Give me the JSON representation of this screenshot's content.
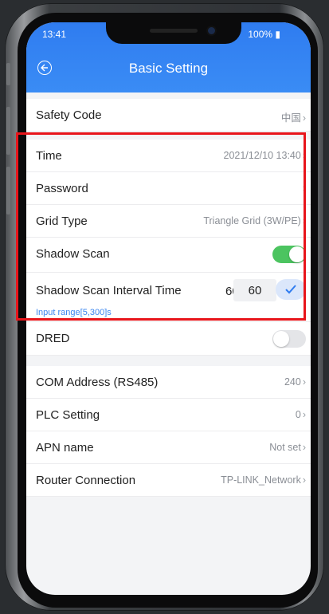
{
  "status_bar": {
    "time": "13:41",
    "battery": "100%"
  },
  "header": {
    "title": "Basic Setting"
  },
  "settings": {
    "safety_code": {
      "label": "Safety Code",
      "value": "中国"
    },
    "time": {
      "label": "Time",
      "value": "2021/12/10 13:40"
    },
    "password": {
      "label": "Password"
    },
    "grid_type": {
      "label": "Grid Type",
      "value": "Triangle Grid (3W/PE)"
    },
    "shadow_scan": {
      "label": "Shadow Scan",
      "enabled": true
    },
    "shadow_scan_interval": {
      "label": "Shadow Scan Interval Time",
      "current": "60",
      "input_value": "60",
      "hint": "Input range[5,300]s"
    },
    "dred": {
      "label": "DRED",
      "enabled": false
    },
    "com_address": {
      "label": "COM Address (RS485)",
      "value": "240"
    },
    "plc_setting": {
      "label": "PLC Setting",
      "value": "0"
    },
    "apn_name": {
      "label": "APN name",
      "value": "Not set"
    },
    "router_connection": {
      "label": "Router Connection",
      "value": "TP-LINK_Network"
    }
  },
  "colors": {
    "accent": "#3a8cf5",
    "toggle_on": "#4cc460",
    "highlight": "#e8151b",
    "hint": "#3b86f0"
  }
}
